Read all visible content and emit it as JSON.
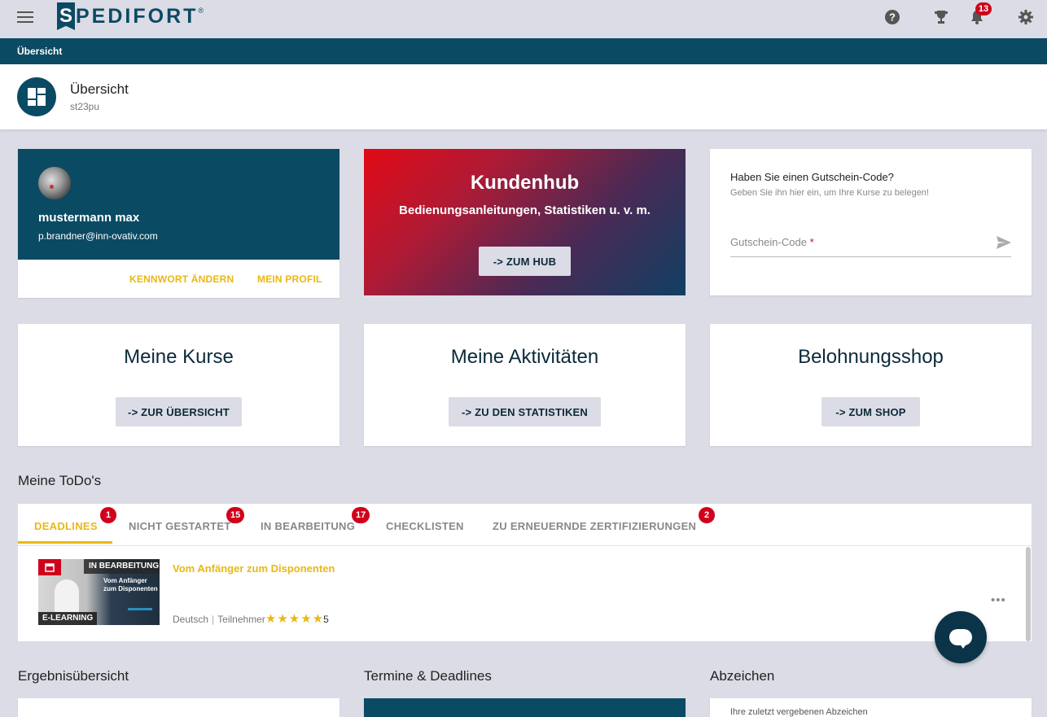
{
  "brand": {
    "logo_letter": "S",
    "logo_text": "PEDIFORT",
    "registered": "®"
  },
  "topbar": {
    "notifications_count": "13"
  },
  "breadcrumb": {
    "current": "Übersicht"
  },
  "page_header": {
    "title": "Übersicht",
    "subtitle": "st23pu"
  },
  "profile": {
    "name": "mustermann max",
    "email": "p.brandner@inn-ovativ.com",
    "change_password": "KENNWORT ÄNDERN",
    "my_profile": "MEIN PROFIL"
  },
  "hub": {
    "title": "Kundenhub",
    "subtitle": "Bedienungsanleitungen, Statistiken u. v. m.",
    "button": "-> ZUM HUB"
  },
  "voucher": {
    "title": "Haben Sie einen Gutschein-Code?",
    "subtitle": "Geben Sie ihn hier ein, um Ihre Kurse zu belegen!",
    "placeholder": "Gutschein-Code",
    "required_mark": "*"
  },
  "features": [
    {
      "title": "Meine Kurse",
      "button": "-> ZUR ÜBERSICHT"
    },
    {
      "title": "Meine Aktivitäten",
      "button": "-> ZU DEN STATISTIKEN"
    },
    {
      "title": "Belohnungsshop",
      "button": "-> ZUM SHOP"
    }
  ],
  "todos": {
    "title": "Meine ToDo's",
    "tabs": [
      {
        "label": "DEADLINES",
        "badge": "1"
      },
      {
        "label": "NICHT GESTARTET",
        "badge": "15"
      },
      {
        "label": "IN BEARBEITUNG",
        "badge": "17"
      },
      {
        "label": "CHECKLISTEN",
        "badge": ""
      },
      {
        "label": "ZU ERNEUERNDE ZERTIFIZIERUNGEN",
        "badge": "2"
      }
    ],
    "active_tab": "DEADLINES",
    "items": [
      {
        "status": "IN BEARBEITUNG",
        "thumb_text_1": "Vom Anfänger",
        "thumb_text_2": "zum Disponenten",
        "thumb_label": "E-LEARNING",
        "title": "Vom Anfänger zum Disponenten",
        "language": "Deutsch",
        "separator": "|",
        "participants": "Teilnehmer",
        "rating": "5"
      }
    ],
    "more": "•••"
  },
  "sections": {
    "results": "Ergebnisübersicht",
    "deadlines": "Termine & Deadlines",
    "badges": "Abzeichen",
    "badges_sub": "Ihre zuletzt vergebenen Abzeichen"
  },
  "colors": {
    "primary": "#0b4a63",
    "accent": "#e8b816",
    "badge": "#d0021b",
    "background": "#dcdce6"
  }
}
